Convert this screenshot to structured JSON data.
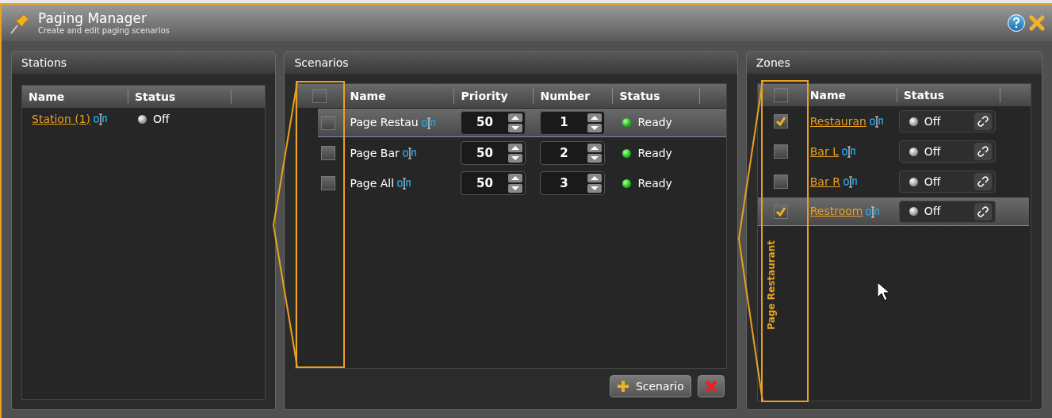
{
  "window": {
    "title": "Paging Manager",
    "subtitle": "Create and edit paging scenarios"
  },
  "stations": {
    "title": "Stations",
    "columns": [
      "Name",
      "Status"
    ],
    "rows": [
      {
        "name": "Station (1)",
        "status": "Off"
      }
    ]
  },
  "scenarios": {
    "title": "Scenarios",
    "select_all": {
      "checked": false
    },
    "columns": [
      "Name",
      "Priority",
      "Number",
      "Status"
    ],
    "rows": [
      {
        "name": "Page Restau",
        "priority": "50",
        "number": "1",
        "status": "Ready",
        "checked": false,
        "selected": true
      },
      {
        "name": "Page Bar",
        "priority": "50",
        "number": "2",
        "status": "Ready",
        "checked": false,
        "selected": false
      },
      {
        "name": "Page All",
        "priority": "50",
        "number": "3",
        "status": "Ready",
        "checked": false,
        "selected": false
      }
    ],
    "buttons": [
      {
        "kind": "add",
        "label": "Scenario"
      },
      {
        "kind": "delete"
      }
    ]
  },
  "zones": {
    "title": "Zones",
    "scenario_label": "Page Restaurant",
    "select_all": {
      "checked": false
    },
    "columns": [
      "Name",
      "Status"
    ],
    "rows": [
      {
        "name": "Restauran",
        "status": "Off",
        "checked": true,
        "selected": false
      },
      {
        "name": "Bar L",
        "status": "Off",
        "checked": false,
        "selected": false
      },
      {
        "name": "Bar R",
        "status": "Off",
        "checked": false,
        "selected": false
      },
      {
        "name": "Restroom",
        "status": "Off",
        "checked": true,
        "selected": true
      }
    ]
  }
}
